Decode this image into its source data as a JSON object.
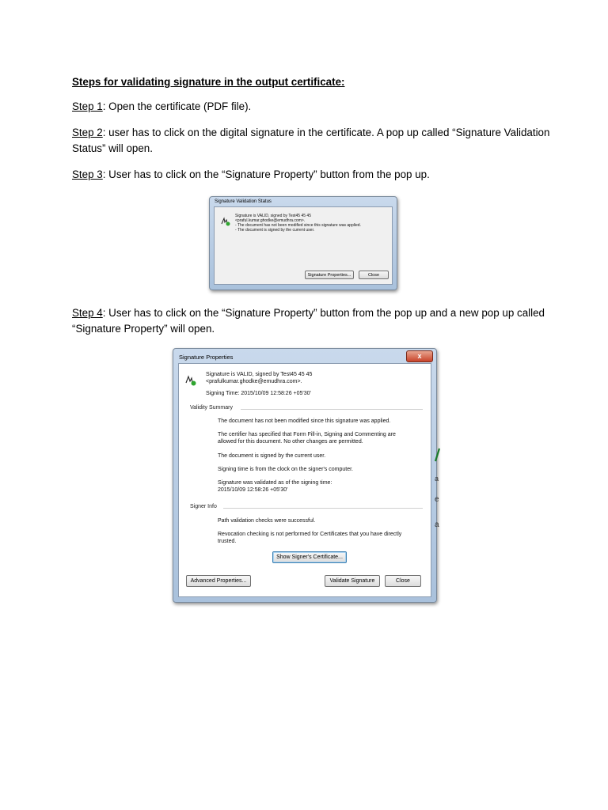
{
  "heading": "Steps for validating signature in the output certificate:",
  "steps": [
    {
      "label": "Step 1",
      "text": ": Open the certificate (PDF file)."
    },
    {
      "label": "Step 2",
      "text": ": user has to click on the digital signature in the certificate. A pop up called “Signature Validation",
      "text2": "Status” will open."
    },
    {
      "label": "Step 3",
      "text": ": User has to click on the “Signature Property” button from the pop up."
    },
    {
      "label": "Step 4",
      "text": ": User has to click on the “Signature Property” button from the pop up and a new pop up called",
      "text2": "“Signature Property” will open."
    }
  ],
  "dialog1": {
    "title": "Signature Validation Status",
    "line1": "Signature is VALID, signed by Test45 45 45",
    "line2": "<praful.kumar.ghodke@emudhra.com>.",
    "line3": "- The document has not been modified since this signature was applied.",
    "line4": "- The document is signed by the current user.",
    "btn_props": "Signature Properties...",
    "btn_close": "Close"
  },
  "dialog2": {
    "title": "Signature Properties",
    "sig_line1": "Signature is VALID, signed by Test45 45 45",
    "sig_line2": "<prafulkumar.ghodke@emudhra.com>.",
    "signing_time": "Signing Time:  2015/10/09 12:58:26 +05'30'",
    "validity_title": "Validity Summary",
    "v1": "The document has not been modified since this signature was applied.",
    "v2a": "The certifier has specified that Form Fill-in, Signing and Commenting are",
    "v2b": "allowed for this document. No other changes are permitted.",
    "v3": "The document is signed by the current user.",
    "v4": "Signing time is from the clock on the signer's computer.",
    "v5a": "Signature was validated as of the signing time:",
    "v5b": "2015/10/09 12:58:26 +05'30'",
    "signer_title": "Signer Info",
    "s1": "Path validation checks were successful.",
    "s2a": "Revocation checking is not performed for Certificates that you have directly",
    "s2b": "trusted.",
    "btn_show_cert": "Show Signer's Certificate...",
    "btn_advanced": "Advanced Properties...",
    "btn_validate": "Validate Signature",
    "btn_close": "Close",
    "close_x": "x"
  },
  "bg_fragments": [
    "a",
    "e",
    "a"
  ]
}
